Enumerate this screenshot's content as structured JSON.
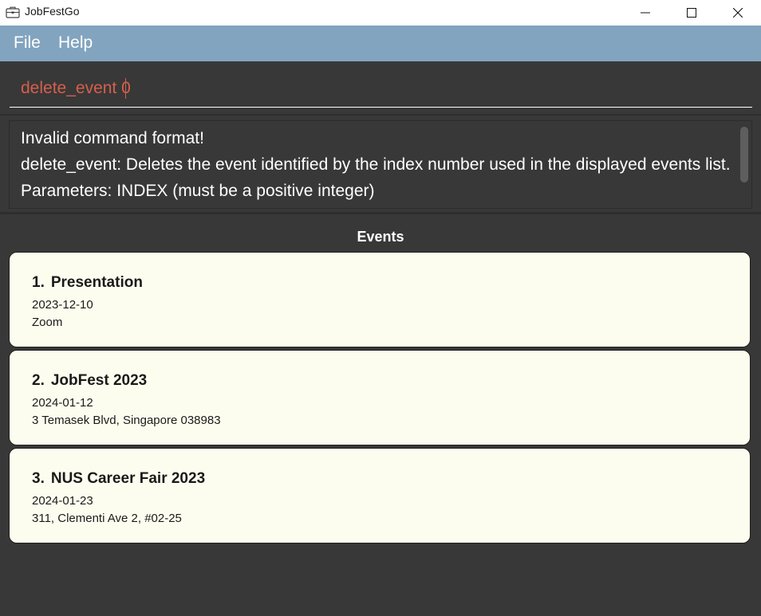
{
  "window": {
    "title": "JobFestGo",
    "icon": "briefcase-icon"
  },
  "menu": {
    "file_label": "File",
    "help_label": "Help"
  },
  "command": {
    "value": "delete_event 0",
    "text_color": "#d65f4b"
  },
  "result": {
    "lines": [
      "Invalid command format!",
      "delete_event: Deletes the event identified by the index number used in the displayed events list.",
      "Parameters: INDEX (must be a positive integer)"
    ]
  },
  "events": {
    "heading": "Events",
    "items": [
      {
        "index": "1.",
        "name": "Presentation",
        "date": "2023-12-10",
        "location": "Zoom"
      },
      {
        "index": "2.",
        "name": "JobFest 2023",
        "date": "2024-01-12",
        "location": "3 Temasek Blvd, Singapore 038983"
      },
      {
        "index": "3.",
        "name": "NUS Career Fair 2023",
        "date": "2024-01-23",
        "location": "311, Clementi Ave 2, #02-25"
      }
    ]
  },
  "colors": {
    "menu_bar": "#82a4bf",
    "background": "#383838",
    "card_background": "#fdfdef"
  }
}
